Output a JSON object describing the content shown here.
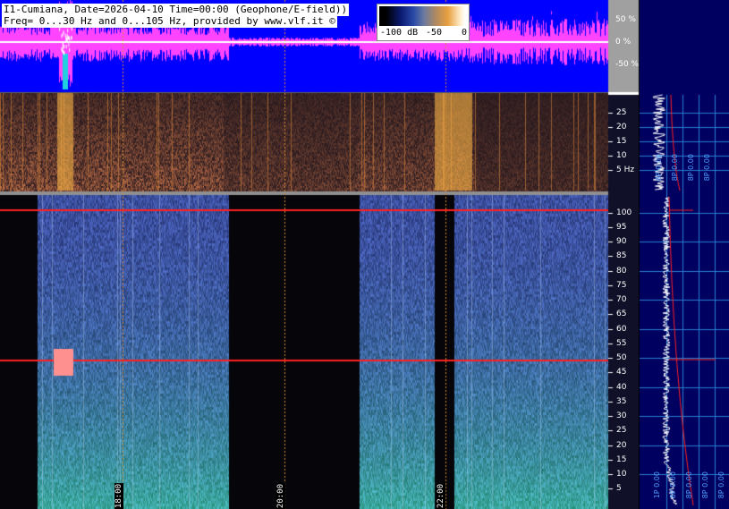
{
  "header": {
    "line1": "I1-Cumiana, Date=2026-04-10 Time=00:00 (Geophone/E-field))",
    "line2": "Freq= 0...30 Hz and 0...105 Hz, provided by www.vlf.it ©"
  },
  "colorbar": {
    "labels": [
      "-100 dB",
      "-50",
      "0"
    ],
    "colors": [
      "#000000",
      "#0a1a70",
      "#2a4aa8",
      "#6a7aa0",
      "#b08a60",
      "#e8a040",
      "#fff0d0"
    ]
  },
  "colors": {
    "waveform_bg": "#0000ff",
    "waveform_trace": "#ff44ff",
    "spectrogram_bg": "#0a0a22",
    "side_panel_bg": "#000060",
    "axis_panel_bg": "#a0a0a0",
    "side_grid": "#2a7fd0",
    "marker_line": "#ff2020",
    "time_marker": "#d08a30"
  },
  "waveform_axis": [
    "50 %",
    "0 %",
    "-50 %"
  ],
  "low_spec_axis": [
    "25",
    "20",
    "15",
    "10",
    "5 Hz"
  ],
  "high_spec_axis": [
    "100",
    "95",
    "90",
    "85",
    "80",
    "75",
    "70",
    "65",
    "60",
    "55",
    "50",
    "45",
    "40",
    "35",
    "30",
    "25",
    "20",
    "15",
    "10",
    "5"
  ],
  "low_side_labels": [
    "8P 0.00",
    "8P 0.00",
    "8P 0.00",
    "8P 0.00"
  ],
  "high_side_labels": [
    "1P 0.00",
    "8P 0.00",
    "8P 0.00",
    "8P 0.00",
    "8P 0.00"
  ],
  "time_labels": [
    {
      "label": "18:00"
    },
    {
      "label": "20:00"
    },
    {
      "label": "22:00"
    }
  ],
  "chart_data": {
    "type": "heatmap",
    "title": "I1-Cumiana, Date=2026-04-10 Time=00:00 (Geophone/E-field))",
    "panels": [
      {
        "name": "waveform",
        "y_ticks": [
          "50 %",
          "0 %",
          "-50 %"
        ]
      },
      {
        "name": "spectrogram 0-30 Hz",
        "y_ticks": [
          25,
          20,
          15,
          10,
          5
        ],
        "ylabel": "Hz",
        "ylim": [
          0,
          30
        ]
      },
      {
        "name": "spectrogram 0-105 Hz",
        "y_ticks": [
          100,
          95,
          90,
          85,
          80,
          75,
          70,
          65,
          60,
          55,
          50,
          45,
          40,
          35,
          30,
          25,
          20,
          15,
          10,
          5
        ],
        "ylim": [
          0,
          105
        ]
      }
    ],
    "x_ticks": [
      "18:00",
      "20:00",
      "22:00"
    ],
    "colorbar_ticks": [
      "-100 dB",
      "-50",
      "0"
    ],
    "highlighted_lines_hz": [
      50,
      100
    ]
  }
}
